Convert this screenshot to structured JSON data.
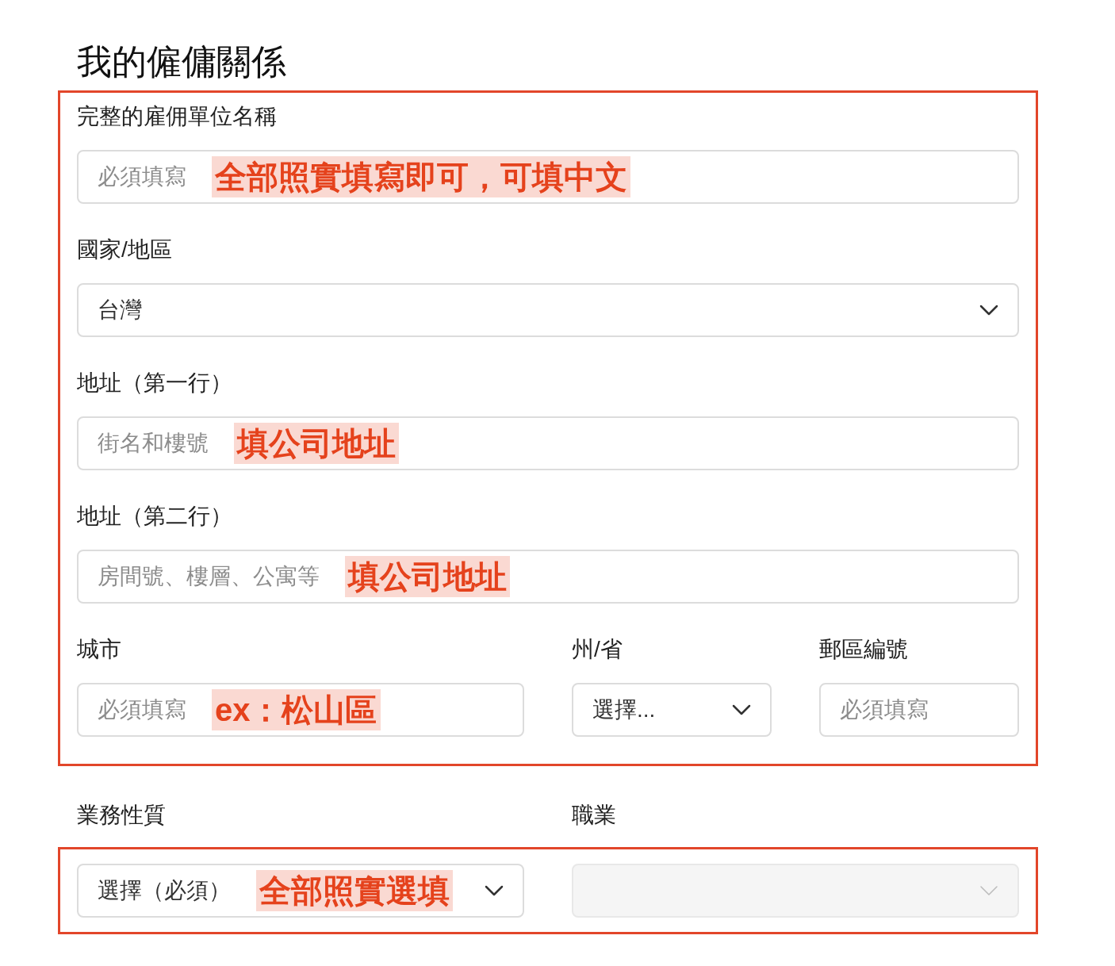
{
  "title": "我的僱傭關係",
  "groups": [
    {
      "labels_outside": false,
      "rows": [
        [
          {
            "label": "完整的雇佣單位名稱",
            "kind": "text",
            "placeholder": "必須填寫",
            "note": "全部照實填寫即可，可填中文"
          }
        ],
        [
          {
            "label": "國家/地區",
            "kind": "select",
            "value": "台灣"
          }
        ],
        [
          {
            "label": "地址（第一行）",
            "kind": "text",
            "placeholder": "街名和樓號",
            "note": "填公司地址"
          }
        ],
        [
          {
            "label": "地址（第二行）",
            "kind": "text",
            "placeholder": "房間號、樓層、公寓等",
            "note": "填公司地址"
          }
        ],
        [
          {
            "label": "城市",
            "kind": "text",
            "placeholder": "必須填寫",
            "note": "ex：松山區"
          },
          {
            "label": "州/省",
            "kind": "select",
            "value": "選擇..."
          },
          {
            "label": "郵區編號",
            "kind": "text",
            "placeholder": "必須填寫"
          }
        ]
      ]
    },
    {
      "labels_outside": true,
      "rows": [
        [
          {
            "label": "業務性質",
            "kind": "select",
            "value": "選擇（必須）",
            "note": "全部照實選填"
          },
          {
            "label": "職業",
            "kind": "select",
            "disabled": true
          }
        ]
      ]
    }
  ]
}
